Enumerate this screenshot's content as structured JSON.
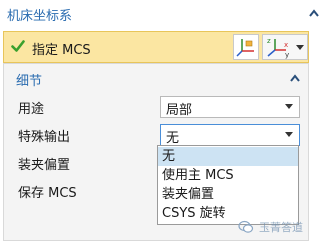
{
  "panel": {
    "title": "机床坐标系"
  },
  "specify_mcs": {
    "label": "指定 MCS"
  },
  "details": {
    "title": "细节",
    "fields": {
      "purpose": {
        "label": "用途",
        "value": "局部"
      },
      "special_output": {
        "label": "特殊输出",
        "value": "无"
      },
      "fixture_offset": {
        "label": "装夹偏置"
      },
      "save_mcs": {
        "label": "保存 MCS"
      }
    }
  },
  "dropdown": {
    "options": [
      "无",
      "使用主 MCS",
      "装夹偏置",
      "CSYS 旋转"
    ],
    "selected": "无"
  },
  "watermark": {
    "text": "玉菁答道"
  },
  "colors": {
    "accent": "#2a6cb0",
    "highlight_row": "#fbe6a2",
    "selected_option": "#cde3f3",
    "check_green": "#3aa02e"
  },
  "icons": {
    "check": "check-icon",
    "csys_dialog": "csys-dialog-icon",
    "axes": "xyz-axes-icon",
    "collapse": "chevron-up-icon"
  }
}
